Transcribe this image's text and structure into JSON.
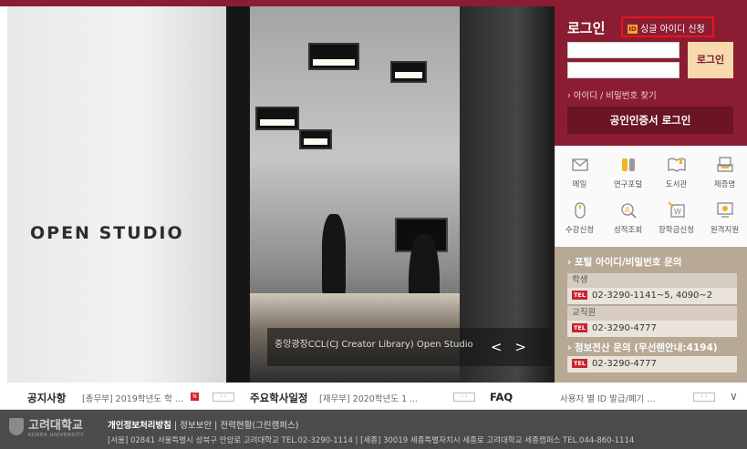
{
  "hero": {
    "sign_text": "OPEN STUDIO",
    "caption": "중앙광장CCL(CJ Creator Library) Open Studio",
    "prev_label": "<",
    "next_label": ">"
  },
  "login": {
    "title": "로그인",
    "single_id_badge": "ID",
    "single_id_label": "싱글 아이디 신청",
    "button": "로그인",
    "find_link": "› 아이디 / 비밀번호 찾기",
    "cert_button": "공인인증서 로그인"
  },
  "quick_links": [
    {
      "label": "메일",
      "icon": "mail-icon"
    },
    {
      "label": "연구포털",
      "icon": "research-portal-icon"
    },
    {
      "label": "도서관",
      "icon": "library-icon"
    },
    {
      "label": "제증명",
      "icon": "certificate-icon"
    },
    {
      "label": "수강신청",
      "icon": "course-registration-icon"
    },
    {
      "label": "성적조회",
      "icon": "grade-search-icon"
    },
    {
      "label": "장학금신청",
      "icon": "scholarship-icon"
    },
    {
      "label": "원격지원",
      "icon": "remote-support-icon"
    }
  ],
  "contact": {
    "portal_title": "› 포털 아이디/비밀번호 문의",
    "student_label": "학생",
    "student_tel": "02-3290-1141~5, 4090~2",
    "staff_label": "교직원",
    "staff_tel": "02-3290-4777",
    "it_title": "› 정보전산 문의 (무선랜안내:4194)",
    "it_tel": "02-3290-4777",
    "tel_badge": "TEL"
  },
  "notice_bar": {
    "notice_title": "공지사항",
    "notice_text": "[총무부] 2019학년도 학 ...",
    "new_badge": "N",
    "schedule_title": "주요학사일정",
    "schedule_text": "[재무부] 2020학년도 1 ...",
    "faq_title": "FAQ",
    "faq_text": "사용자 별 ID 발급/폐기 ...",
    "ctrl_label": "‹ ›",
    "expand_label": "∨"
  },
  "footer": {
    "logo_text": "고려대학교",
    "logo_sub": "KOREA UNIVERSITY",
    "privacy": "개인정보처리방침",
    "sep": " | ",
    "security": "정보보안",
    "power": "전력현황(그린캠퍼스)",
    "address": "[서울] 02841 서울특별시 성북구 안암로 고려대학교 TEL.02-3290-1114 | [세종] 30019 세종특별자치시 세종로 고려대학교 세종캠퍼스 TEL.044-860-1114"
  },
  "colors": {
    "brand": "#8b1d32",
    "highlight": "#e8141c",
    "contact_bg": "#b7a996"
  }
}
